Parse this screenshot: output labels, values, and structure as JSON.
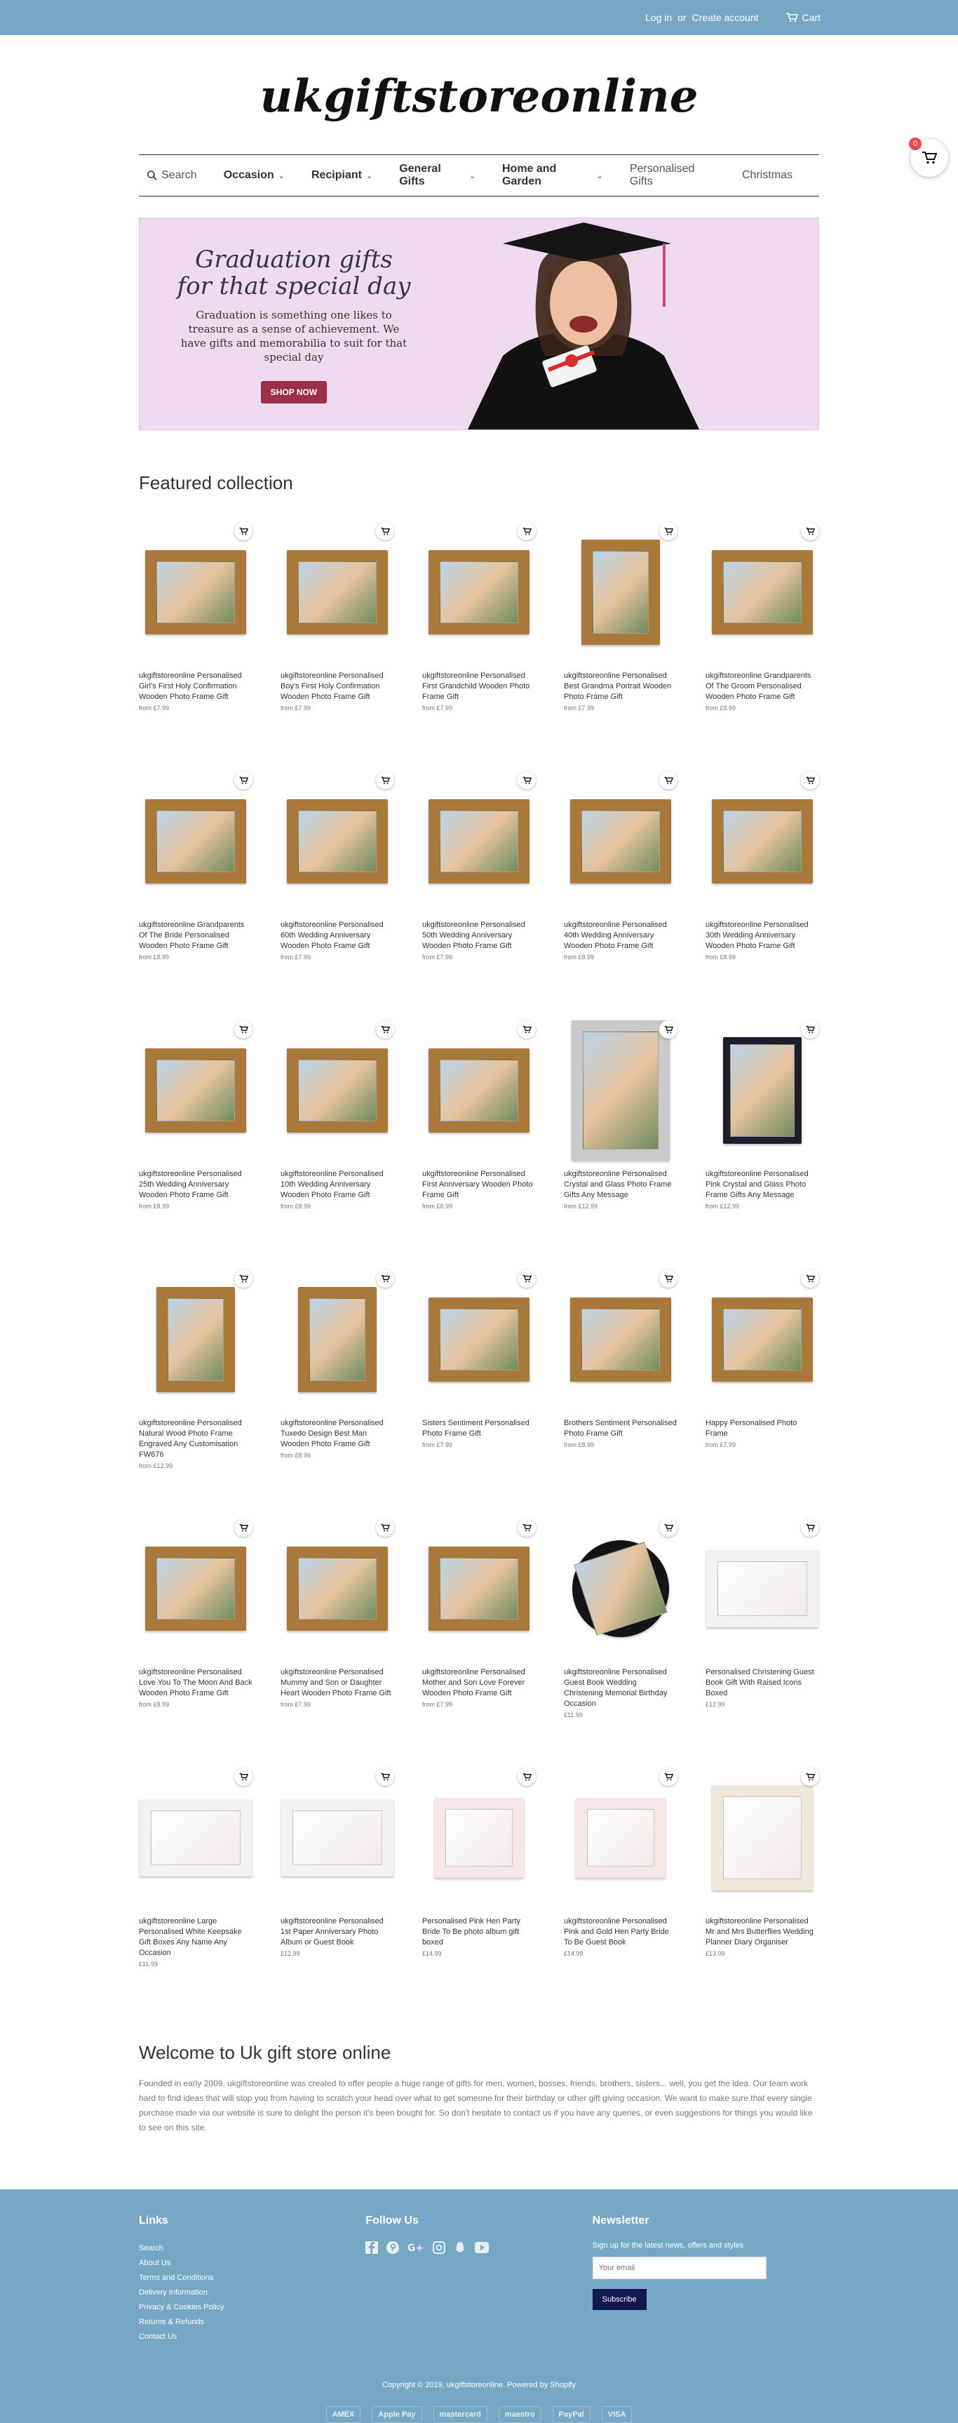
{
  "topbar": {
    "login": "Log in",
    "or": "or",
    "create_account": "Create account",
    "cart": "Cart"
  },
  "logo": "ukgiftstoreonline",
  "nav": {
    "search": "Search",
    "items": [
      {
        "label": "Occasion",
        "dropdown": true
      },
      {
        "label": "Recipiant",
        "dropdown": true
      },
      {
        "label": "General Gifts",
        "dropdown": true
      },
      {
        "label": "Home and Garden",
        "dropdown": true
      },
      {
        "label": "Personalised Gifts",
        "dropdown": false
      },
      {
        "label": "Christmas",
        "dropdown": false
      }
    ]
  },
  "cart_count": "0",
  "hero": {
    "title": "Graduation gifts for that special day",
    "body": "Graduation is something one likes to treasure as a sense of achievement. We have gifts and memorabilia to suit for that special day",
    "button": "SHOP NOW"
  },
  "featured_title": "Featured collection",
  "products": [
    {
      "title": "ukgiftstoreonline Personalised Girl's First Holy Confirmation Wooden Photo Frame Gift",
      "price": "from £7.99",
      "style": ""
    },
    {
      "title": "ukgiftstoreonline Personalised Boy's First Holy Confirmation Wooden Photo Frame Gift",
      "price": "from £7.99",
      "style": ""
    },
    {
      "title": "ukgiftstoreonline Personalised First Grandchild Wooden Photo Frame Gift",
      "price": "from £7.99",
      "style": ""
    },
    {
      "title": "ukgiftstoreonline Personalised Best Grandma Portrait Wooden Photo Frame Gift",
      "price": "from £7.99",
      "style": "tall"
    },
    {
      "title": "ukgiftstoreonline Grandparents Of The Groom Personalised Wooden Photo Frame Gift",
      "price": "from £8.99",
      "style": ""
    },
    {
      "title": "ukgiftstoreonline Grandparents Of The Bride Personalised Wooden Photo Frame Gift",
      "price": "from £8.99",
      "style": ""
    },
    {
      "title": "ukgiftstoreonline Personalised 60th Wedding Anniversary Wooden Photo Frame Gift",
      "price": "from £7.99",
      "style": ""
    },
    {
      "title": "ukgiftstoreonline Personalised 50th Wedding Anniversary Wooden Photo Frame Gift",
      "price": "from £7.99",
      "style": ""
    },
    {
      "title": "ukgiftstoreonline Personalised 40th Wedding Anniversary Wooden Photo Frame Gift",
      "price": "from £8.99",
      "style": ""
    },
    {
      "title": "ukgiftstoreonline Personalised 30th Wedding Anniversary Wooden Photo Frame Gift",
      "price": "from £8.99",
      "style": ""
    },
    {
      "title": "ukgiftstoreonline Personalised 25th Wedding Anniversary Wooden Photo Frame Gift",
      "price": "from £8.99",
      "style": ""
    },
    {
      "title": "ukgiftstoreonline Personalised 10th Wedding Anniversary Wooden Photo Frame Gift",
      "price": "from £8.99",
      "style": ""
    },
    {
      "title": "ukgiftstoreonline Personalised First Anniversary Wooden Photo Frame Gift",
      "price": "from £8.99",
      "style": ""
    },
    {
      "title": "ukgiftstoreonline Personalised Crystal and Glass Photo Frame Gifts Any Message",
      "price": "from £12.99",
      "style": "silver"
    },
    {
      "title": "ukgiftstoreonline Personalised Pink Crystal and Glass Photo Frame Gifts Any Message",
      "price": "from £12.99",
      "style": "black"
    },
    {
      "title": "ukgiftstoreonline Personalised Natural Wood Photo Frame Engraved Any Customisation FW676",
      "price": "from £12.99",
      "style": "tall"
    },
    {
      "title": "ukgiftstoreonline Personalised Tuxedo Design Best Man Wooden Photo Frame Gift",
      "price": "from £8.99",
      "style": "tall"
    },
    {
      "title": "Sisters Sentiment Personalised Photo Frame Gift",
      "price": "from £7.99",
      "style": ""
    },
    {
      "title": "Brothers Sentiment Personalised Photo Frame Gift",
      "price": "from £8.99",
      "style": ""
    },
    {
      "title": "Happy Personalised Photo Frame",
      "price": "from £7.99",
      "style": ""
    },
    {
      "title": "ukgiftstoreonline Personalised Love You To The Moon And Back Wooden Photo Frame Gift",
      "price": "from £8.99",
      "style": ""
    },
    {
      "title": "ukgiftstoreonline Personalised Mummy and Son or Daughter Heart Wooden Photo Frame Gift",
      "price": "from £7.99",
      "style": ""
    },
    {
      "title": "ukgiftstoreonline Personalised Mother and Son Love Forever Wooden Photo Frame Gift",
      "price": "from £7.99",
      "style": ""
    },
    {
      "title": "ukgiftstoreonline Personalised Guest Book Wedding Christening Memorial Birthday Occasion",
      "price": "£11.99",
      "style": "blackbook"
    },
    {
      "title": "Personalised Christening Guest Book Gift With Raised Icons Boxed",
      "price": "£12.99",
      "style": "white"
    },
    {
      "title": "ukgiftstoreonline Large Personalised White Keepsake Gift Boxes Any Name Any Occasion",
      "price": "£11.99",
      "style": "white"
    },
    {
      "title": "ukgiftstoreonline Personalised 1st Paper Anniversary Photo Album or Guest Book",
      "price": "£12.99",
      "style": "white"
    },
    {
      "title": "Personalised Pink Hen Party Bride To Be photo album gift boxed",
      "price": "£14.99",
      "style": "pink"
    },
    {
      "title": "ukgiftstoreonline Personalised Pink and Gold Hen Party Bride To Be Guest Book",
      "price": "£14.99",
      "style": "pink"
    },
    {
      "title": "ukgiftstoreonline Personalised Mr and Mrs Butterflies Wedding Planner Diary Organiser",
      "price": "£13.99",
      "style": "cream"
    }
  ],
  "welcome": {
    "title": "Welcome to Uk gift store online",
    "body": "Founded in early 2009, ukgiftstoreonline was created to offer people a huge range of gifts for men, women, bosses, friends, brothers, sisters... well, you get the idea. Our team work hard to find ideas that will stop you from having to scratch your head over what to get someone for their birthday or other gift giving occasion. We want to make sure that every single purchase made via our website is sure to delight the person it's been bought for. So don't hesitate to contact us if you have any queries, or even suggestions for things you would like to see on this site."
  },
  "footer": {
    "links_title": "Links",
    "links": [
      "Search",
      "About Us",
      "Terms and Conditions",
      "Delivery Information",
      "Privacy & Cookies Policy",
      "Returns & Refunds",
      "Contact Us"
    ],
    "follow_title": "Follow Us",
    "newsletter_title": "Newsletter",
    "newsletter_text": "Sign up for the latest news, offers and styles",
    "email_placeholder": "Your email",
    "subscribe": "Subscribe",
    "copyright": "Copyright © 2019, ukgiftstoreonline. Powered by Shopify",
    "payments": [
      "AMEX",
      "Apple Pay",
      "mastercard",
      "maestro",
      "PayPal",
      "VISA"
    ]
  },
  "colors": {
    "topbar": "#76a7c4",
    "hero_bg": "#f0daf0",
    "hero_button": "#9c2f4a",
    "subscribe_button": "#111a4e"
  }
}
